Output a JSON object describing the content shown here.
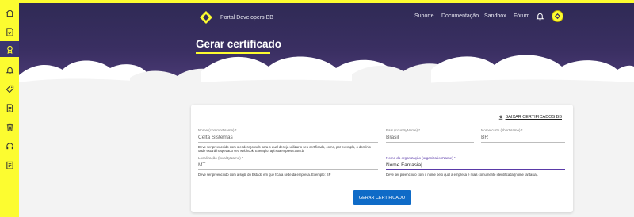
{
  "header": {
    "brand": "Portal Developers BB",
    "nav": [
      "Suporte",
      "Documentação",
      "Sandbox",
      "Fórum"
    ],
    "page_title": "Gerar certificado"
  },
  "card": {
    "download_label": "BAIXAR CERTIFICADOS BB",
    "fields": {
      "common_name": {
        "label": "Nome (commonName) *",
        "value": "Celta Sistemas",
        "help": "Deve ser preenchido com o endereço web para o qual deseja utilizar o seu certificado, como, por exemplo, o domínio onde estará hospedado seu webhook. Exemplo: api.suaempresa.com.br"
      },
      "country": {
        "label": "País (countryName) *",
        "value": "Brasil"
      },
      "short_name": {
        "label": "Nome curto (shortName) *",
        "value": "BR"
      },
      "locality": {
        "label": "Localização (localityName) *",
        "value": "MT",
        "help": "Deve ser preenchido com a sigla do Estado em que fica a sede da empresa. Exemplo: SP"
      },
      "organization": {
        "label": "Nome da organização (organizationName) *",
        "value": "Nome Fantasia|",
        "help": "Deve ser preenchido com o nome pelo qual a empresa é mais comumente identificada (nome fantasia)."
      }
    },
    "submit_label": "GERAR CERTIFICADO"
  },
  "colors": {
    "accent_yellow": "#fcfc30",
    "header_purple": "#2f2a55",
    "button_blue": "#0f6bc7",
    "focus_purple": "#5a3aa8"
  },
  "sidebar_icons": [
    "home-icon",
    "document-check-icon",
    "badge-icon",
    "bell-icon",
    "tag-icon",
    "document-icon",
    "trash-icon",
    "headset-icon",
    "list-document-icon"
  ]
}
